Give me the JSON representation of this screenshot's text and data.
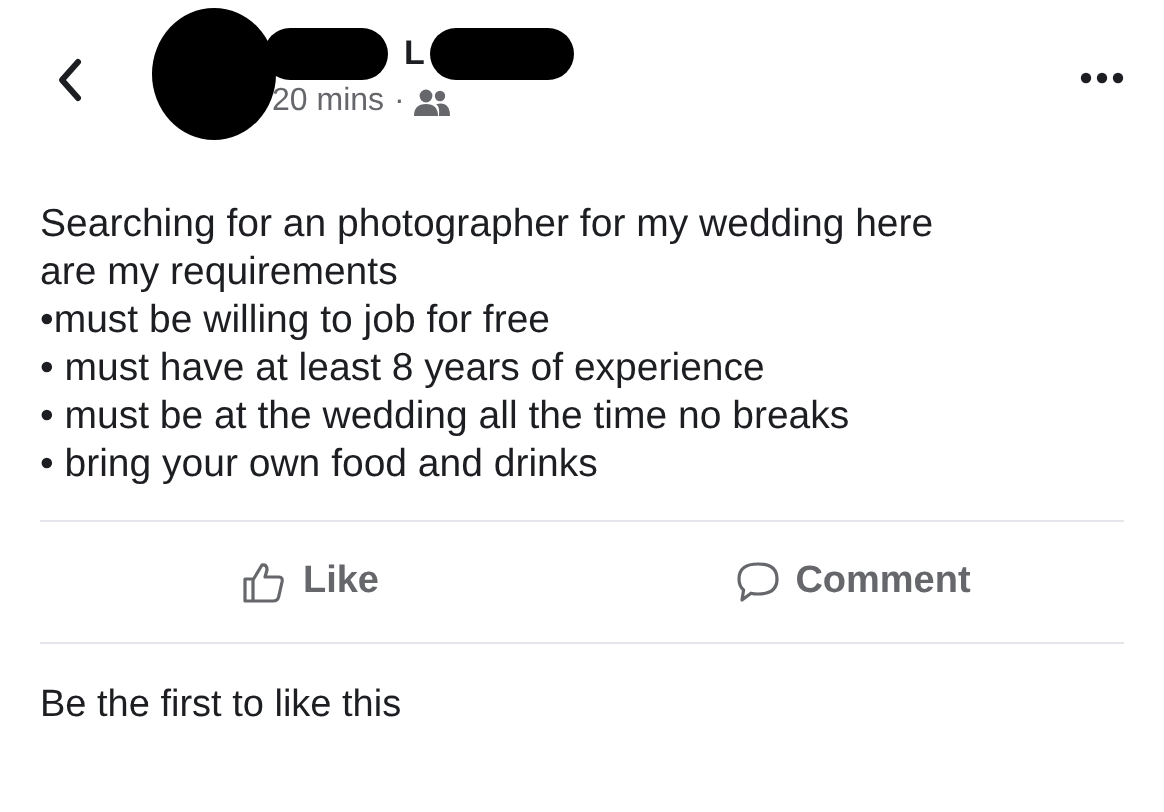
{
  "header": {
    "name": "L",
    "time": "20 mins",
    "separator": "·"
  },
  "post": {
    "lines": [
      {
        "kind": "text",
        "text": "Searching for an photographer for my wedding here"
      },
      {
        "kind": "text",
        "text": "are my requirements"
      },
      {
        "kind": "text",
        "text": "•must be willing to job for free"
      },
      {
        "kind": "text",
        "text": "• must have at least 8 years of experience"
      },
      {
        "kind": "text",
        "text": "• must be at the wedding all the time no breaks"
      },
      {
        "kind": "text",
        "text": "• bring your own food and drinks"
      }
    ]
  },
  "actions": [
    {
      "kind": "like",
      "label": "Like"
    },
    {
      "kind": "comment",
      "label": "Comment"
    }
  ],
  "likes_summary": "Be the first to like this"
}
